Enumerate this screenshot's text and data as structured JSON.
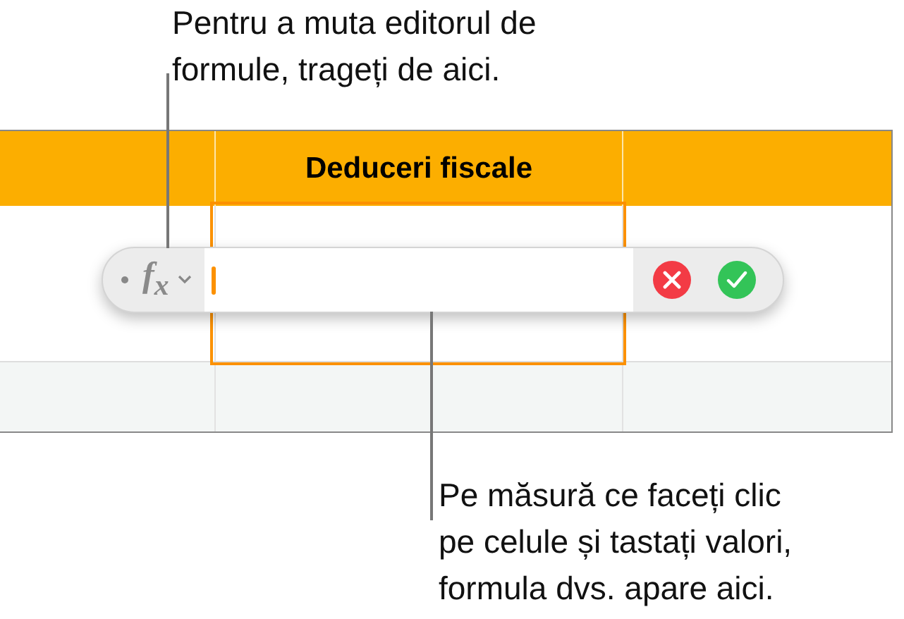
{
  "callouts": [
    {
      "text": "Pentru a muta editorul de\nformule, trageți de aici."
    },
    {
      "text": "Pe măsură ce faceți clic\npe celule și tastați valori,\nformula dvs. apare aici."
    }
  ],
  "table": {
    "header": {
      "label": "Deduceri fiscale"
    },
    "rows": [
      {
        "cells": [
          {
            "selected": false
          },
          {
            "selected": true
          },
          {
            "selected": false
          }
        ]
      },
      {
        "cells": [
          {
            "selected": false
          },
          {
            "selected": false
          },
          {
            "selected": false
          }
        ]
      }
    ]
  },
  "formula_editor": {
    "function_label": "f$_{x}$"
  }
}
